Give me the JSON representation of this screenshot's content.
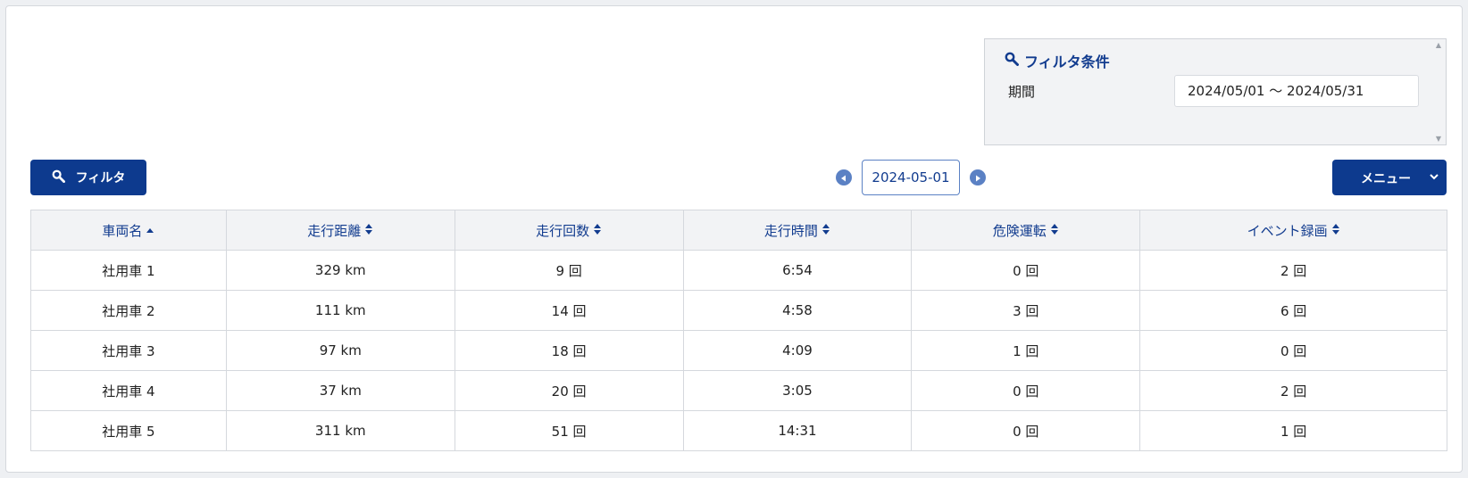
{
  "filter_panel": {
    "title": "フィルタ条件",
    "period_label": "期間",
    "period_value": "2024/05/01 〜 2024/05/31"
  },
  "toolbar": {
    "filter_button": "フィルタ",
    "date": "2024-05-01",
    "menu_button": "メニュー"
  },
  "table": {
    "columns": [
      {
        "label": "車両名",
        "sort": "asc"
      },
      {
        "label": "走行距離",
        "sort": "both"
      },
      {
        "label": "走行回数",
        "sort": "both"
      },
      {
        "label": "走行時間",
        "sort": "both"
      },
      {
        "label": "危険運転",
        "sort": "both"
      },
      {
        "label": "イベント録画",
        "sort": "both"
      }
    ],
    "rows": [
      [
        "社用車 1",
        "329 km",
        "9 回",
        "6:54",
        "0 回",
        "2 回"
      ],
      [
        "社用車 2",
        "111 km",
        "14 回",
        "4:58",
        "3 回",
        "6 回"
      ],
      [
        "社用車 3",
        "97 km",
        "18 回",
        "4:09",
        "1 回",
        "0 回"
      ],
      [
        "社用車 4",
        "37 km",
        "20 回",
        "3:05",
        "0 回",
        "2 回"
      ],
      [
        "社用車 5",
        "311 km",
        "51 回",
        "14:31",
        "0 回",
        "1 回"
      ]
    ]
  },
  "colors": {
    "primary": "#0d3a8e",
    "accent": "#5b81c4",
    "header_bg": "#f2f3f5"
  },
  "icons": {
    "filter": "search-icon",
    "prev": "circle-left-icon",
    "next": "circle-right-icon",
    "menu": "chevron-down-icon"
  }
}
